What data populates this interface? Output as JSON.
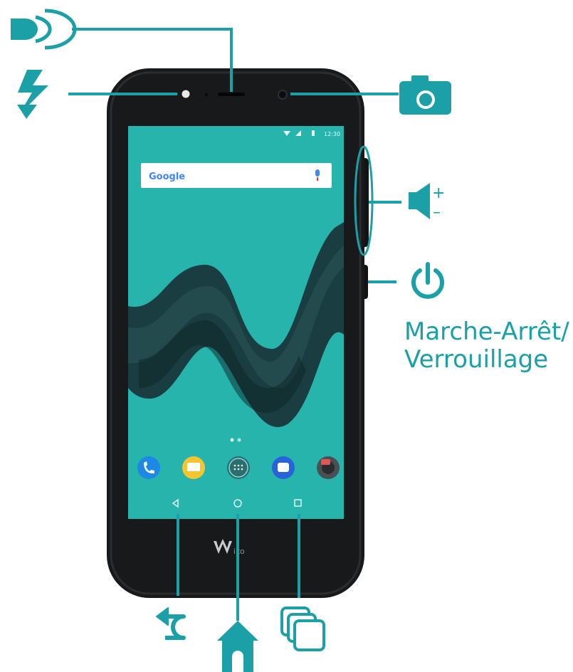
{
  "colors": {
    "accent": "#1aa0a6",
    "phone_body": "#17191b",
    "screen_bg": "#27b4ad",
    "wallpaper_wave": "#18373a"
  },
  "callouts": {
    "speaker_icon": "speaker-icon",
    "flash_icon": "flash-icon",
    "camera_icon": "front-camera-icon",
    "volume_icon": "volume-plus-minus-icon",
    "power_icon": "power-icon",
    "back_icon": "back-arrow-icon",
    "home_icon": "home-icon",
    "recents_icon": "recent-apps-icon",
    "volume_plus": "+",
    "volume_minus": "–",
    "power_label_line1": "Marche-Arrêt/",
    "power_label_line2": "Verrouillage"
  },
  "phone": {
    "status_time": "12:30",
    "search_logo": "Google",
    "brand": "Wiko",
    "dock_apps": [
      "phone-app",
      "messaging-app",
      "app-drawer",
      "chat-app",
      "camera-app"
    ]
  }
}
